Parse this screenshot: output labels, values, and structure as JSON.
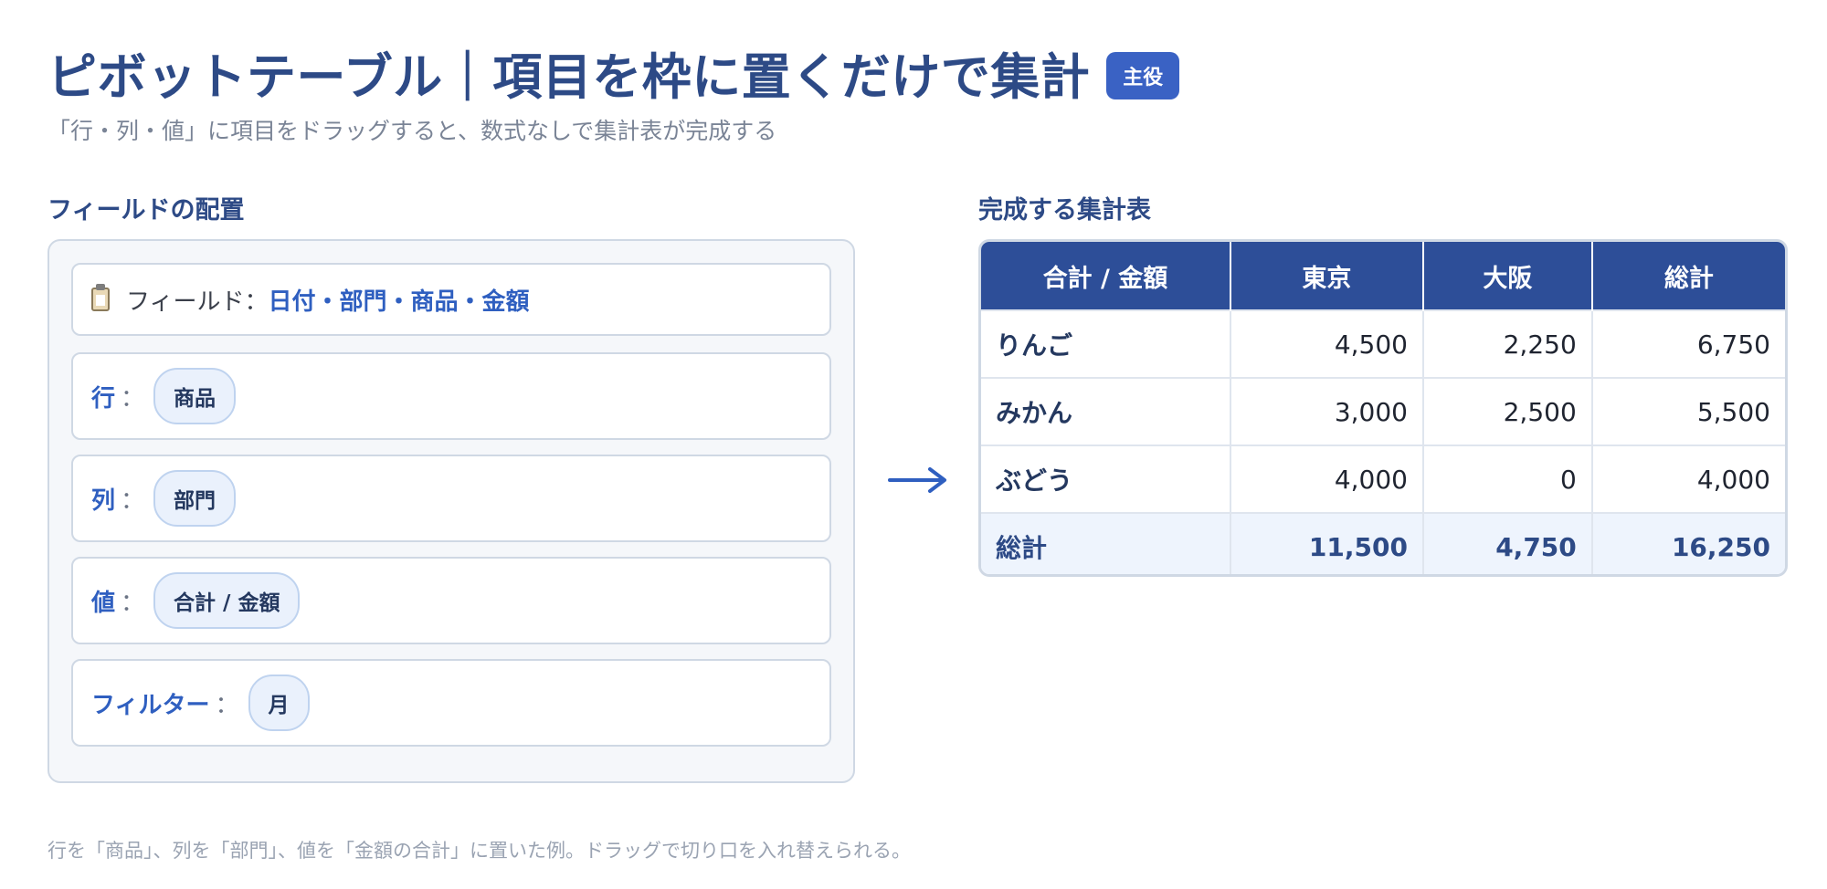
{
  "header": {
    "title": "ピボットテーブル｜項目を枠に置くだけで集計",
    "badge": "主役",
    "subtitle": "「行・列・値」に項目をドラッグすると、数式なしで集計表が完成する"
  },
  "left": {
    "section_title": "フィールドの配置",
    "fields_prefix": "フィールド：",
    "fields_list": "日付・部門・商品・金額",
    "icon": "clipboard-icon",
    "slots": [
      {
        "label": "行",
        "chip": "商品"
      },
      {
        "label": "列",
        "chip": "部門"
      },
      {
        "label": "値",
        "chip": "合計 / 金額"
      },
      {
        "label": "フィルター",
        "chip": "月"
      }
    ],
    "separator": "："
  },
  "arrow_icon": "arrow-right-icon",
  "right": {
    "section_title": "完成する集計表",
    "table": {
      "headers": [
        "合計 / 金額",
        "東京",
        "大阪",
        "総計"
      ],
      "rows": [
        [
          "りんご",
          "4,500",
          "2,250",
          "6,750"
        ],
        [
          "みかん",
          "3,000",
          "2,500",
          "5,500"
        ],
        [
          "ぶどう",
          "4,000",
          "0",
          "4,000"
        ]
      ],
      "total": [
        "総計",
        "11,500",
        "4,750",
        "16,250"
      ]
    }
  },
  "footnote": "行を「商品」、列を「部門」、値を「金額の合計」に置いた例。ドラッグで切り口を入れ替えられる。",
  "colors": {
    "accent": "#2d4a86",
    "header_fill": "#2d4e98",
    "badge": "#3a62c4",
    "chip_fill": "#eaf1fc",
    "total_row_fill": "#eef4fd"
  }
}
